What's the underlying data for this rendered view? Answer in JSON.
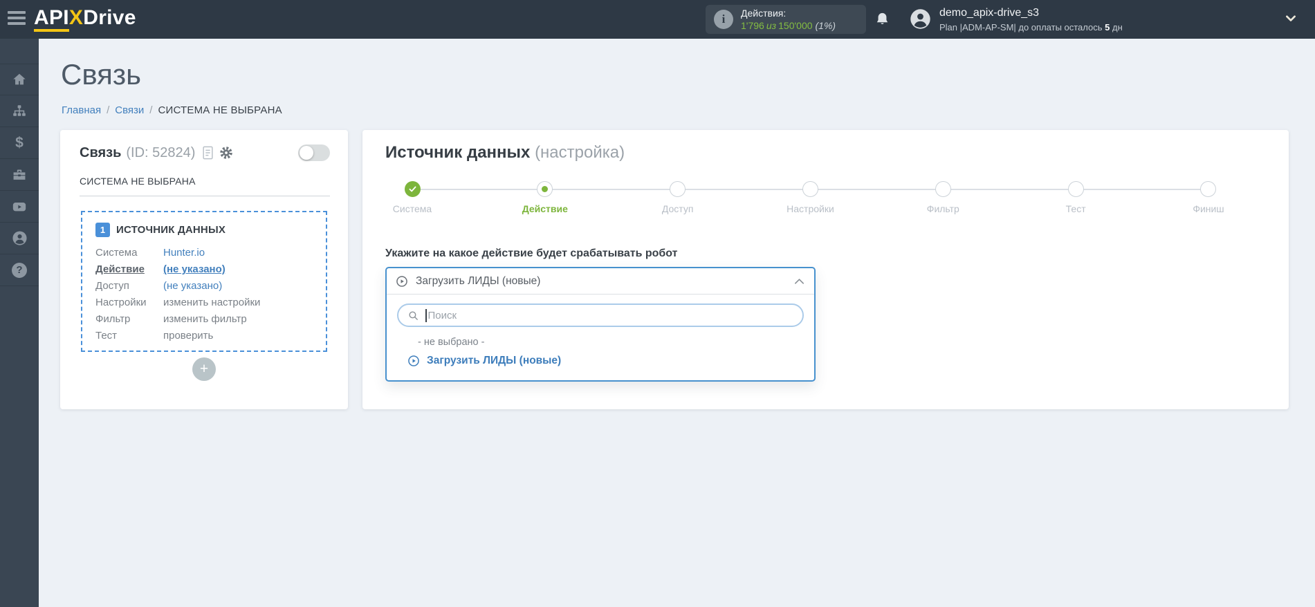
{
  "header": {
    "logo": {
      "api": "API",
      "x": "X",
      "drive": "Drive"
    },
    "actions": {
      "label": "Действия:",
      "info_glyph": "i",
      "used": "1'796",
      "of_word": "из",
      "total": "150'000",
      "percent": "(1%)"
    },
    "user": {
      "name": "demo_apix-drive_s3",
      "plan_text": "Plan |ADM-AP-SM| до оплаты осталось",
      "days": "5",
      "days_unit": "дн"
    }
  },
  "sidebar": {
    "items": [
      {
        "icon": "home-icon"
      },
      {
        "icon": "connections-icon"
      },
      {
        "icon": "billing-icon",
        "glyph": "$"
      },
      {
        "icon": "services-icon"
      },
      {
        "icon": "video-icon"
      },
      {
        "icon": "account-icon"
      },
      {
        "icon": "help-icon",
        "glyph": "?"
      }
    ]
  },
  "page": {
    "title": "Связь",
    "breadcrumb": [
      "Главная",
      "Связи",
      "СИСТЕМА НЕ ВЫБРАНА"
    ],
    "breadcrumb_sep": "/"
  },
  "connection_card": {
    "title": "Связь",
    "id": "(ID: 52824)",
    "status": "СИСТЕМА НЕ ВЫБРАНА",
    "source_block": {
      "badge": "1",
      "title": "ИСТОЧНИК ДАННЫХ",
      "rows": [
        {
          "label": "Система",
          "value": "Hunter.io"
        },
        {
          "label": "Действие",
          "value": "(не указано)"
        },
        {
          "label": "Доступ",
          "value": "(не указано)"
        },
        {
          "label": "Настройки",
          "value": "изменить настройки"
        },
        {
          "label": "Фильтр",
          "value": "изменить фильтр"
        },
        {
          "label": "Тест",
          "value": "проверить"
        }
      ]
    },
    "add_button_label": "+"
  },
  "setup": {
    "title": "Источник данных",
    "title_suffix": "(настройка)",
    "steps": [
      {
        "label": "Система",
        "state": "done"
      },
      {
        "label": "Действие",
        "state": "active"
      },
      {
        "label": "Доступ",
        "state": "pending"
      },
      {
        "label": "Настройки",
        "state": "pending"
      },
      {
        "label": "Фильтр",
        "state": "pending"
      },
      {
        "label": "Тест",
        "state": "pending"
      },
      {
        "label": "Финиш",
        "state": "pending"
      }
    ],
    "question": "Укажите на какое действие будет срабатывать робот",
    "select_value": "Загрузить ЛИДЫ (новые)",
    "search_placeholder": "Поиск",
    "options": [
      {
        "label": "- не выбрано -"
      },
      {
        "label": "Загрузить ЛИДЫ (новые)"
      }
    ]
  },
  "colors": {
    "accent_blue": "#4a90d9",
    "link_blue": "#4380bd",
    "green": "#7db53c",
    "border_blue": "#4791ce",
    "yellow": "#f3c515",
    "header_bg": "#2e3945",
    "sidebar_bg": "#3a4653"
  }
}
